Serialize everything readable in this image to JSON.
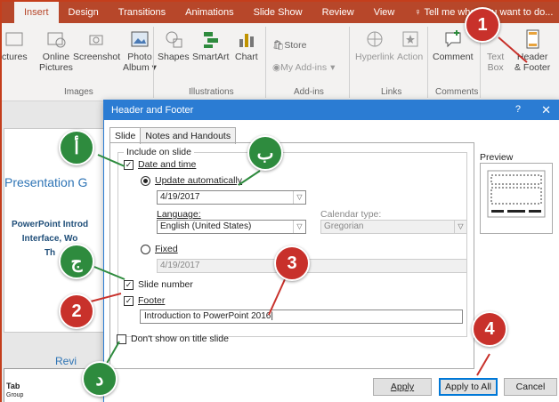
{
  "ribbon": {
    "tabs": [
      "Insert",
      "Design",
      "Transitions",
      "Animations",
      "Slide Show",
      "Review",
      "View",
      "Tell me what you want to do..."
    ],
    "buttons": {
      "pictures": "ctures",
      "online_pictures_1": "Online",
      "online_pictures_2": "Pictures",
      "screenshot": "Screenshot",
      "photo_album_1": "Photo",
      "photo_album_2": "Album",
      "shapes": "Shapes",
      "smartart": "SmartArt",
      "chart": "Chart",
      "store": "Store",
      "my_addins": "My Add-ins",
      "hyperlink": "Hyperlink",
      "action": "Action",
      "comment": "Comment",
      "text_box_1": "Text",
      "text_box_2": "Box",
      "header_footer_1": "Header",
      "header_footer_2": "& Footer"
    },
    "groups": {
      "images": "Images",
      "illustrations": "Illustrations",
      "addins": "Add-ins",
      "links": "Links",
      "comments": "Comments"
    }
  },
  "slide": {
    "title": "Presentation G",
    "body_1": "PowerPoint Introd",
    "body_2": "Interface, Wo",
    "body_3": "Th",
    "review": "Revi",
    "tab_label": "Tab",
    "group_label": "Group"
  },
  "dialog": {
    "title": "Header and Footer",
    "help": "?",
    "close": "✕",
    "tabs": [
      "Slide",
      "Notes and Handouts"
    ],
    "include_label": "Include on slide",
    "date_time": "Date and time",
    "update_auto": "Update automatically",
    "date_value": "4/19/2017",
    "language_label": "Language:",
    "language_value": "English (United States)",
    "calendar_label": "Calendar type:",
    "calendar_value": "Gregorian",
    "fixed": "Fixed",
    "fixed_value": "4/19/2017",
    "slide_number": "Slide number",
    "footer": "Footer",
    "footer_value": "Introduction to PowerPoint 2016",
    "dont_show": "Don't show on title slide",
    "preview": "Preview",
    "apply": "Apply",
    "apply_all": "Apply to All",
    "cancel": "Cancel",
    "checked": {
      "date_time": true,
      "slide_number": true,
      "footer": true,
      "dont_show": false
    }
  },
  "callouts": {
    "red": [
      "1",
      "2",
      "3",
      "4"
    ],
    "green": [
      "أ",
      "ب",
      "ج",
      "د"
    ]
  },
  "colors": {
    "accent": "#b7472a",
    "dialog": "#2b7cd3",
    "red_marker": "#c8312b",
    "green_marker": "#2e8b3e"
  }
}
